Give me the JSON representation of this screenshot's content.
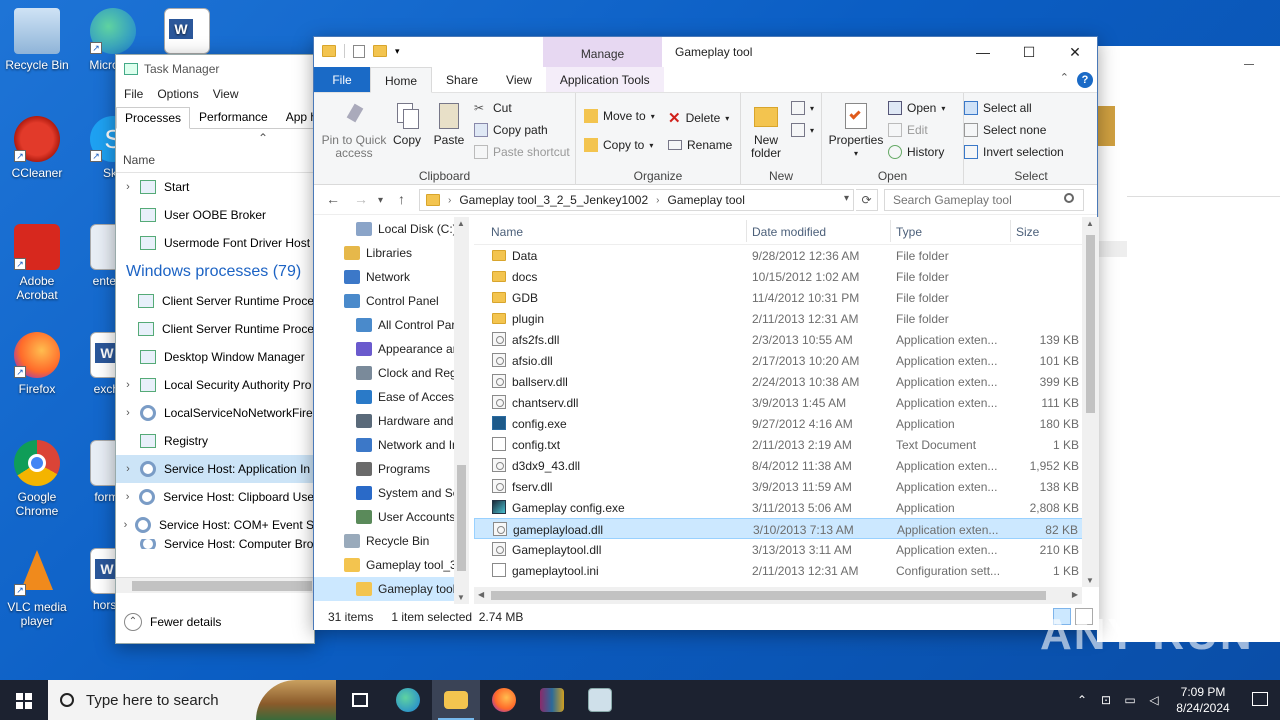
{
  "desktop_icons": [
    {
      "label": "Recycle Bin"
    },
    {
      "label": "Micro Ed"
    },
    {
      "label": "CCleaner"
    },
    {
      "label": "Sky"
    },
    {
      "label": "Adobe Acrobat"
    },
    {
      "label": "enterbe"
    },
    {
      "label": "Firefox"
    },
    {
      "label": "exchan"
    },
    {
      "label": "Google Chrome"
    },
    {
      "label": "formen"
    },
    {
      "label": "VLC media player"
    },
    {
      "label": "horsem"
    }
  ],
  "task_manager": {
    "title": "Task Manager",
    "menu": [
      "File",
      "Options",
      "View"
    ],
    "tabs": [
      "Processes",
      "Performance",
      "App histo"
    ],
    "col_name": "Name",
    "apps": [
      "Start",
      "User OOBE Broker",
      "Usermode Font Driver Host"
    ],
    "section": "Windows processes (79)",
    "procs": [
      "Client Server Runtime Proce",
      "Client Server Runtime Proce",
      "Desktop Window Manager",
      "Local Security Authority Pro",
      "LocalServiceNoNetworkFire",
      "Registry",
      "Service Host: Application In",
      "Service Host: Clipboard Use",
      "Service Host: COM+ Event S",
      "Service Host: Computer Bro"
    ],
    "fewer_details": "Fewer details"
  },
  "explorer": {
    "window_title": "Gameplay tool",
    "manage_label": "Manage",
    "tabs": {
      "file": "File",
      "home": "Home",
      "share": "Share",
      "view": "View",
      "app_tools": "Application Tools"
    },
    "ribbon": {
      "pin": "Pin to Quick access",
      "copy": "Copy",
      "paste": "Paste",
      "cut": "Cut",
      "copy_path": "Copy path",
      "paste_shortcut": "Paste shortcut",
      "clipboard": "Clipboard",
      "move_to": "Move to",
      "copy_to": "Copy to",
      "delete": "Delete",
      "rename": "Rename",
      "organize": "Organize",
      "new_folder": "New folder",
      "new": "New",
      "properties": "Properties",
      "open_btn": "Open",
      "edit": "Edit",
      "history": "History",
      "open_group": "Open",
      "select_all": "Select all",
      "select_none": "Select none",
      "invert_selection": "Invert selection",
      "select_group": "Select"
    },
    "breadcrumb": [
      "Gameplay tool_3_2_5_Jenkey1002",
      "Gameplay tool"
    ],
    "search_placeholder": "Search Gameplay tool",
    "nav_pane": [
      {
        "label": "Local Disk (C:)",
        "indent": 1,
        "color": "#8aa4c8"
      },
      {
        "label": "Libraries",
        "indent": 0,
        "color": "#e6b84a"
      },
      {
        "label": "Network",
        "indent": 0,
        "color": "#3c78c8"
      },
      {
        "label": "Control Panel",
        "indent": 0,
        "color": "#4a8acb"
      },
      {
        "label": "All Control Par",
        "indent": 1,
        "color": "#4a8acb"
      },
      {
        "label": "Appearance an",
        "indent": 1,
        "color": "#6a5acd"
      },
      {
        "label": "Clock and Regi",
        "indent": 1,
        "color": "#7a8a9a"
      },
      {
        "label": "Ease of Access",
        "indent": 1,
        "color": "#2a7ac8"
      },
      {
        "label": "Hardware and",
        "indent": 1,
        "color": "#5a6a7a"
      },
      {
        "label": "Network and Ir",
        "indent": 1,
        "color": "#3c78c8"
      },
      {
        "label": "Programs",
        "indent": 1,
        "color": "#6a6a6a"
      },
      {
        "label": "System and Sec",
        "indent": 1,
        "color": "#2a6ac8"
      },
      {
        "label": "User Accounts",
        "indent": 1,
        "color": "#5a8a5a"
      },
      {
        "label": "Recycle Bin",
        "indent": 0,
        "color": "#9ab"
      },
      {
        "label": "Gameplay tool_3",
        "indent": 0,
        "color": "#f3c44f"
      },
      {
        "label": "Gameplay tool",
        "indent": 1,
        "color": "#f3c44f",
        "selected": true
      }
    ],
    "columns": {
      "name": "Name",
      "date": "Date modified",
      "type": "Type",
      "size": "Size"
    },
    "files": [
      {
        "name": "Data",
        "date": "9/28/2012 12:36 AM",
        "type": "File folder",
        "size": "",
        "icon": "folder"
      },
      {
        "name": "docs",
        "date": "10/15/2012 1:02 AM",
        "type": "File folder",
        "size": "",
        "icon": "folder"
      },
      {
        "name": "GDB",
        "date": "11/4/2012 10:31 PM",
        "type": "File folder",
        "size": "",
        "icon": "folder"
      },
      {
        "name": "plugin",
        "date": "2/11/2013 12:31 AM",
        "type": "File folder",
        "size": "",
        "icon": "folder"
      },
      {
        "name": "afs2fs.dll",
        "date": "2/3/2013 10:55 AM",
        "type": "Application exten...",
        "size": "139 KB",
        "icon": "dll"
      },
      {
        "name": "afsio.dll",
        "date": "2/17/2013 10:20 AM",
        "type": "Application exten...",
        "size": "101 KB",
        "icon": "dll"
      },
      {
        "name": "ballserv.dll",
        "date": "2/24/2013 10:38 AM",
        "type": "Application exten...",
        "size": "399 KB",
        "icon": "dll"
      },
      {
        "name": "chantserv.dll",
        "date": "3/9/2013 1:45 AM",
        "type": "Application exten...",
        "size": "111 KB",
        "icon": "dll"
      },
      {
        "name": "config.exe",
        "date": "9/27/2012 4:16 AM",
        "type": "Application",
        "size": "180 KB",
        "icon": "exe"
      },
      {
        "name": "config.txt",
        "date": "2/11/2013 2:19 AM",
        "type": "Text Document",
        "size": "1 KB",
        "icon": "txt"
      },
      {
        "name": "d3dx9_43.dll",
        "date": "8/4/2012 11:38 AM",
        "type": "Application exten...",
        "size": "1,952 KB",
        "icon": "dll"
      },
      {
        "name": "fserv.dll",
        "date": "3/9/2013 11:59 AM",
        "type": "Application exten...",
        "size": "138 KB",
        "icon": "dll"
      },
      {
        "name": "Gameplay config.exe",
        "date": "3/11/2013 5:06 AM",
        "type": "Application",
        "size": "2,808 KB",
        "icon": "game"
      },
      {
        "name": "gameplayload.dll",
        "date": "3/10/2013 7:13 AM",
        "type": "Application exten...",
        "size": "82 KB",
        "icon": "dll",
        "selected": true
      },
      {
        "name": "Gameplaytool.dll",
        "date": "3/13/2013 3:11 AM",
        "type": "Application exten...",
        "size": "210 KB",
        "icon": "dll"
      },
      {
        "name": "gameplaytool.ini",
        "date": "2/11/2013 12:31 AM",
        "type": "Configuration sett...",
        "size": "1 KB",
        "icon": "ini"
      }
    ],
    "status": {
      "items": "31 items",
      "selected": "1 item selected  2.74 MB"
    }
  },
  "watermark": "ANY RUN",
  "taskbar": {
    "search_placeholder": "Type here to search",
    "time": "7:09 PM",
    "date": "8/24/2024"
  }
}
